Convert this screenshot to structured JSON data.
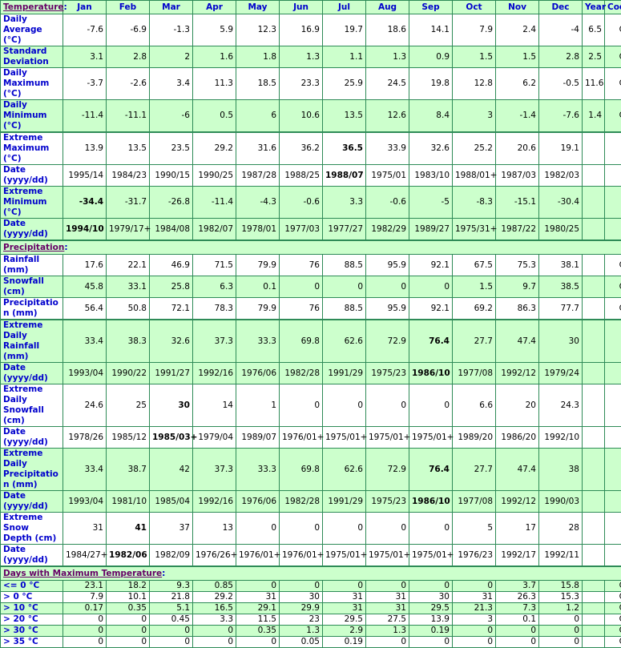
{
  "header": {
    "months": [
      "Jan",
      "Feb",
      "Mar",
      "Apr",
      "May",
      "Jun",
      "Jul",
      "Aug",
      "Sep",
      "Oct",
      "Nov",
      "Dec"
    ],
    "year": "Year",
    "code": "Code"
  },
  "sections": {
    "temperature": "Temperature",
    "precipitation": "Precipitation",
    "days_max_temp": "Days with Maximum Temperature"
  },
  "temperature_rows": [
    {
      "label": "Daily Average (°C)",
      "values": [
        "-7.6",
        "-6.9",
        "-1.3",
        "5.9",
        "12.3",
        "16.9",
        "19.7",
        "18.6",
        "14.1",
        "7.9",
        "2.4",
        "-4"
      ],
      "year": "6.5",
      "code": "C",
      "bg": "w"
    },
    {
      "label": "Standard Deviation",
      "values": [
        "3.1",
        "2.8",
        "2",
        "1.6",
        "1.8",
        "1.3",
        "1.1",
        "1.3",
        "0.9",
        "1.5",
        "1.5",
        "2.8"
      ],
      "year": "2.5",
      "code": "C",
      "bg": "g"
    },
    {
      "label": "Daily Maximum (°C)",
      "values": [
        "-3.7",
        "-2.6",
        "3.4",
        "11.3",
        "18.5",
        "23.3",
        "25.9",
        "24.5",
        "19.8",
        "12.8",
        "6.2",
        "-0.5"
      ],
      "year": "11.6",
      "code": "C",
      "bg": "w"
    },
    {
      "label": "Daily Minimum (°C)",
      "values": [
        "-11.4",
        "-11.1",
        "-6",
        "0.5",
        "6",
        "10.6",
        "13.5",
        "12.6",
        "8.4",
        "3",
        "-1.4",
        "-7.6"
      ],
      "year": "1.4",
      "code": "C",
      "bg": "g"
    },
    {
      "label": "Extreme Maximum (°C)",
      "values": [
        "13.9",
        "13.5",
        "23.5",
        "29.2",
        "31.6",
        "36.2",
        "36.5",
        "33.9",
        "32.6",
        "25.2",
        "20.6",
        "19.1"
      ],
      "year": "",
      "code": "",
      "bg": "w",
      "bold": [
        6
      ]
    },
    {
      "label": "Date (yyyy/dd)",
      "values": [
        "1995/14",
        "1984/23",
        "1990/15",
        "1990/25",
        "1987/28",
        "1988/25",
        "1988/07",
        "1975/01",
        "1983/10",
        "1988/01+",
        "1987/03",
        "1982/03"
      ],
      "year": "",
      "code": "",
      "bg": "w",
      "bold": [
        6
      ]
    },
    {
      "label": "Extreme Minimum (°C)",
      "values": [
        "-34.4",
        "-31.7",
        "-26.8",
        "-11.4",
        "-4.3",
        "-0.6",
        "3.3",
        "-0.6",
        "-5",
        "-8.3",
        "-15.1",
        "-30.4"
      ],
      "year": "",
      "code": "",
      "bg": "g",
      "bold": [
        0
      ]
    },
    {
      "label": "Date (yyyy/dd)",
      "values": [
        "1994/10",
        "1979/17+",
        "1984/08",
        "1982/07",
        "1978/01",
        "1977/03",
        "1977/27",
        "1982/29",
        "1989/27",
        "1975/31+",
        "1987/22",
        "1980/25"
      ],
      "year": "",
      "code": "",
      "bg": "g",
      "bold": [
        0
      ]
    }
  ],
  "precipitation_rows": [
    {
      "label": "Rainfall (mm)",
      "values": [
        "17.6",
        "22.1",
        "46.9",
        "71.5",
        "79.9",
        "76",
        "88.5",
        "95.9",
        "92.1",
        "67.5",
        "75.3",
        "38.1"
      ],
      "year": "",
      "code": "C",
      "bg": "w"
    },
    {
      "label": "Snowfall (cm)",
      "values": [
        "45.8",
        "33.1",
        "25.8",
        "6.3",
        "0.1",
        "0",
        "0",
        "0",
        "0",
        "1.5",
        "9.7",
        "38.5"
      ],
      "year": "",
      "code": "C",
      "bg": "g"
    },
    {
      "label": "Precipitation (mm)",
      "values": [
        "56.4",
        "50.8",
        "72.1",
        "78.3",
        "79.9",
        "76",
        "88.5",
        "95.9",
        "92.1",
        "69.2",
        "86.3",
        "77.7"
      ],
      "year": "",
      "code": "C",
      "bg": "w"
    },
    {
      "label": "Extreme Daily Rainfall (mm)",
      "values": [
        "33.4",
        "38.3",
        "32.6",
        "37.3",
        "33.3",
        "69.8",
        "62.6",
        "72.9",
        "76.4",
        "27.7",
        "47.4",
        "30"
      ],
      "year": "",
      "code": "",
      "bg": "g",
      "bold": [
        8
      ]
    },
    {
      "label": "Date (yyyy/dd)",
      "values": [
        "1993/04",
        "1990/22",
        "1991/27",
        "1992/16",
        "1976/06",
        "1982/28",
        "1991/29",
        "1975/23",
        "1986/10",
        "1977/08",
        "1992/12",
        "1979/24"
      ],
      "year": "",
      "code": "",
      "bg": "g",
      "bold": [
        8
      ]
    },
    {
      "label": "Extreme Daily Snowfall (cm)",
      "values": [
        "24.6",
        "25",
        "30",
        "14",
        "1",
        "0",
        "0",
        "0",
        "0",
        "6.6",
        "20",
        "24.3"
      ],
      "year": "",
      "code": "",
      "bg": "w",
      "bold": [
        2
      ]
    },
    {
      "label": "Date (yyyy/dd)",
      "values": [
        "1978/26",
        "1985/12",
        "1985/03+",
        "1979/04",
        "1989/07",
        "1976/01+",
        "1975/01+",
        "1975/01+",
        "1975/01+",
        "1989/20",
        "1986/20",
        "1992/10"
      ],
      "year": "",
      "code": "",
      "bg": "w",
      "bold": [
        2
      ]
    },
    {
      "label": "Extreme Daily Precipitation (mm)",
      "values": [
        "33.4",
        "38.7",
        "42",
        "37.3",
        "33.3",
        "69.8",
        "62.6",
        "72.9",
        "76.4",
        "27.7",
        "47.4",
        "38"
      ],
      "year": "",
      "code": "",
      "bg": "g",
      "bold": [
        8
      ]
    },
    {
      "label": "Date (yyyy/dd)",
      "values": [
        "1993/04",
        "1981/10",
        "1985/04",
        "1992/16",
        "1976/06",
        "1982/28",
        "1991/29",
        "1975/23",
        "1986/10",
        "1977/08",
        "1992/12",
        "1990/03"
      ],
      "year": "",
      "code": "",
      "bg": "g",
      "bold": [
        8
      ]
    },
    {
      "label": "Extreme Snow Depth (cm)",
      "values": [
        "31",
        "41",
        "37",
        "13",
        "0",
        "0",
        "0",
        "0",
        "0",
        "5",
        "17",
        "28"
      ],
      "year": "",
      "code": "",
      "bg": "w",
      "bold": [
        1
      ]
    },
    {
      "label": "Date (yyyy/dd)",
      "values": [
        "1984/27+",
        "1982/06",
        "1982/09",
        "1976/26+",
        "1976/01+",
        "1976/01+",
        "1975/01+",
        "1975/01+",
        "1975/01+",
        "1976/23",
        "1992/17",
        "1992/11"
      ],
      "year": "",
      "code": "",
      "bg": "w",
      "bold": [
        1
      ]
    }
  ],
  "days_rows": [
    {
      "label": "<= 0 °C",
      "values": [
        "23.1",
        "18.2",
        "9.3",
        "0.85",
        "0",
        "0",
        "0",
        "0",
        "0",
        "0",
        "3.7",
        "15.8"
      ],
      "year": "",
      "code": "C",
      "bg": "g"
    },
    {
      "label": "> 0 °C",
      "values": [
        "7.9",
        "10.1",
        "21.8",
        "29.2",
        "31",
        "30",
        "31",
        "31",
        "30",
        "31",
        "26.3",
        "15.3"
      ],
      "year": "",
      "code": "C",
      "bg": "w"
    },
    {
      "label": "> 10 °C",
      "values": [
        "0.17",
        "0.35",
        "5.1",
        "16.5",
        "29.1",
        "29.9",
        "31",
        "31",
        "29.5",
        "21.3",
        "7.3",
        "1.2"
      ],
      "year": "",
      "code": "C",
      "bg": "g"
    },
    {
      "label": "> 20 °C",
      "values": [
        "0",
        "0",
        "0.45",
        "3.3",
        "11.5",
        "23",
        "29.5",
        "27.5",
        "13.9",
        "3",
        "0.1",
        "0"
      ],
      "year": "",
      "code": "C",
      "bg": "w"
    },
    {
      "label": "> 30 °C",
      "values": [
        "0",
        "0",
        "0",
        "0",
        "0.35",
        "1.3",
        "2.9",
        "1.3",
        "0.19",
        "0",
        "0",
        "0"
      ],
      "year": "",
      "code": "C",
      "bg": "g"
    },
    {
      "label": "> 35 °C",
      "values": [
        "0",
        "0",
        "0",
        "0",
        "0",
        "0.05",
        "0.19",
        "0",
        "0",
        "0",
        "0",
        "0"
      ],
      "year": "",
      "code": "C",
      "bg": "w"
    }
  ],
  "colors": {
    "label_blue": "#0000cc",
    "section_purple": "#660066",
    "row_green": "#ccffcc",
    "border_green": "#2e8b57"
  }
}
